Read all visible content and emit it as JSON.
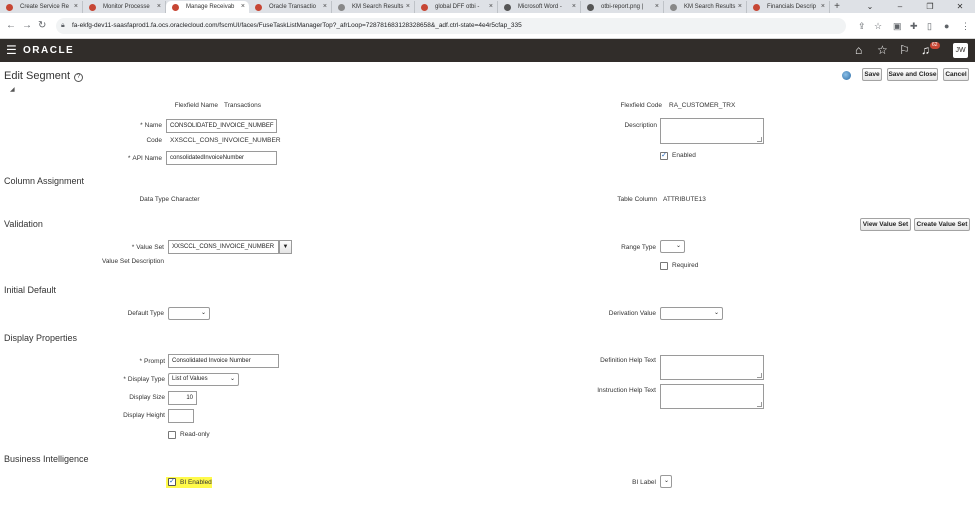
{
  "browser": {
    "tabs": [
      {
        "label": "Create Service Re",
        "color": "#c74634"
      },
      {
        "label": "Monitor Processe",
        "color": "#c74634"
      },
      {
        "label": "Manage Receivab",
        "color": "#c74634"
      },
      {
        "label": "Oracle Transactio",
        "color": "#c74634"
      },
      {
        "label": "KM Search Results",
        "color": "#888888"
      },
      {
        "label": "global DFF otbi -",
        "color": "#c74634"
      },
      {
        "label": "Microsoft Word -",
        "color": "#555555"
      },
      {
        "label": "otbi-report.png |",
        "color": "#555555"
      },
      {
        "label": "KM Search Results",
        "color": "#888888"
      },
      {
        "label": "Financials Descrip",
        "color": "#c74634"
      }
    ],
    "active_tab": 2,
    "url": "fa-ekfg-dev11-saasfaprod1.fa.ocs.oraclecloud.com/fscmUI/faces/FuseTaskListManagerTop?_afrLoop=728781683128328658&_adf.ctrl-state=4e4r5cfap_335"
  },
  "header": {
    "brand": "ORACLE",
    "notification_count": "62",
    "user_initials": "JW"
  },
  "page": {
    "title": "Edit Segment",
    "buttons": {
      "save": "Save",
      "save_close": "Save and Close",
      "cancel": "Cancel"
    }
  },
  "segment": {
    "flexfield_name_label": "Flexfield Name",
    "flexfield_name": "Transactions",
    "flexfield_code_label": "Flexfield Code",
    "flexfield_code": "RA_CUSTOMER_TRX",
    "name_label": "Name",
    "name": "CONSOLIDATED_INVOICE_NUMBEF",
    "code_label": "Code",
    "code": "XXSCCL_CONS_INVOICE_NUMBER",
    "api_name_label": "API Name",
    "api_name": "consolidatedInvoiceNumber",
    "description_label": "Description",
    "description": "",
    "enabled_label": "Enabled",
    "enabled": true
  },
  "column_assignment": {
    "heading": "Column Assignment",
    "data_type_label": "Data Type",
    "data_type": "Character",
    "table_column_label": "Table Column",
    "table_column": "ATTRIBUTE13"
  },
  "validation": {
    "heading": "Validation",
    "view_value_set": "View Value Set",
    "create_value_set": "Create Value Set",
    "value_set_label": "Value Set",
    "value_set": "XXSCCL_CONS_INVOICE_NUMBER",
    "value_set_description_label": "Value Set Description",
    "range_type_label": "Range Type",
    "range_type": "",
    "required_label": "Required",
    "required": false
  },
  "initial_default": {
    "heading": "Initial Default",
    "default_type_label": "Default Type",
    "default_type": "",
    "derivation_value_label": "Derivation Value",
    "derivation_value": ""
  },
  "display_properties": {
    "heading": "Display Properties",
    "prompt_label": "Prompt",
    "prompt": "Consolidated Invoice Number",
    "display_type_label": "Display Type",
    "display_type": "List of Values",
    "display_size_label": "Display Size",
    "display_size": "10",
    "display_height_label": "Display Height",
    "display_height": "",
    "read_only_label": "Read-only",
    "read_only": false,
    "definition_help_label": "Definition Help Text",
    "instruction_help_label": "Instruction Help Text"
  },
  "business_intelligence": {
    "heading": "Business Intelligence",
    "bi_enabled_label": "BI Enabled",
    "bi_enabled": true,
    "bi_label_label": "BI Label",
    "bi_label": "",
    "highlight_color": "#fffa4a"
  }
}
